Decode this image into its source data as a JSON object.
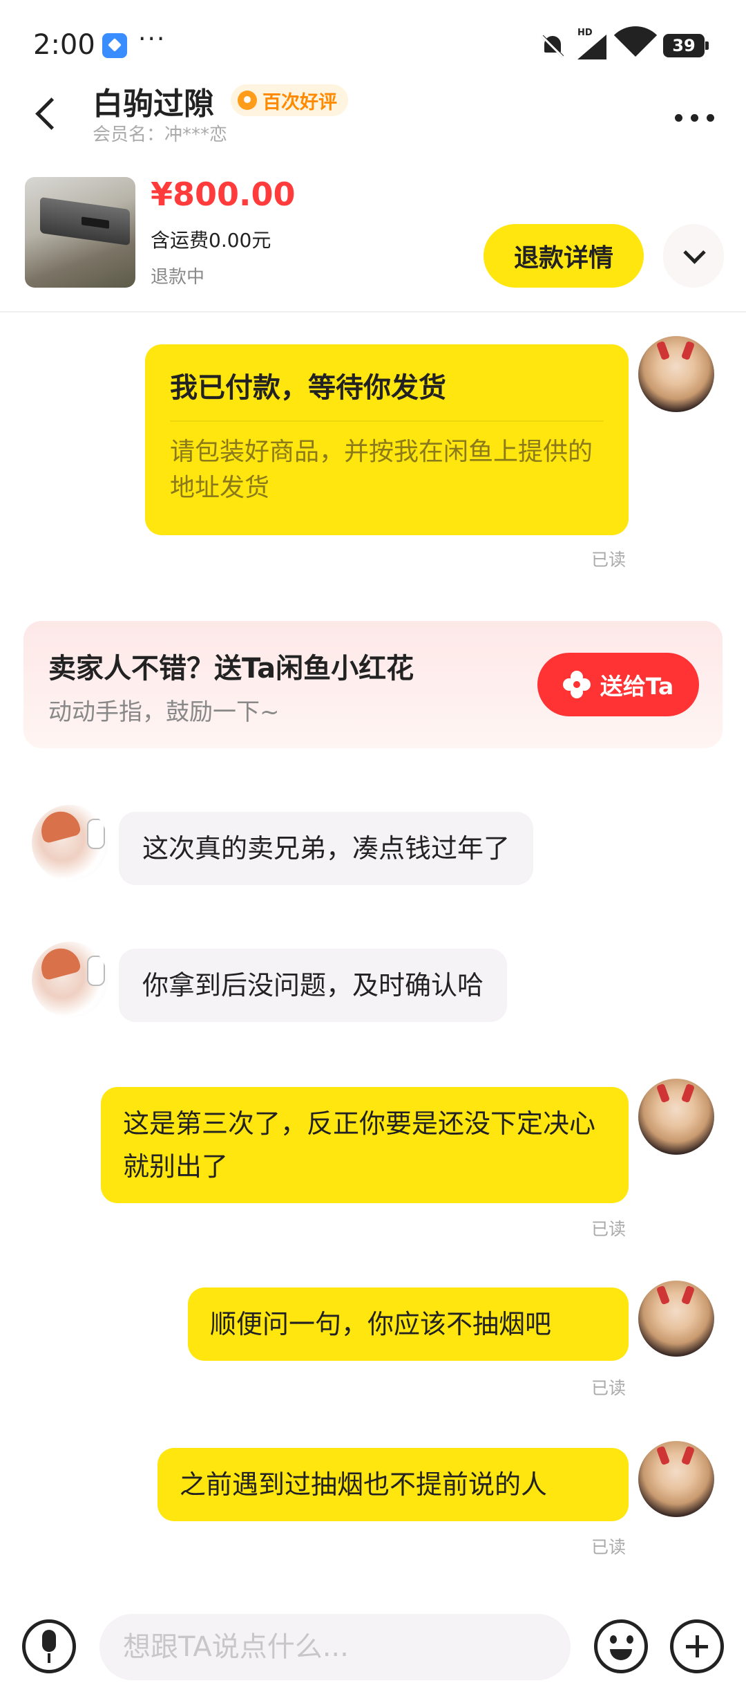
{
  "status_bar": {
    "time": "2:00",
    "network_label": "HD",
    "battery": "39"
  },
  "header": {
    "seller_name": "白驹过隙",
    "badge": "百次好评",
    "member_label": "会员名：冲***恋"
  },
  "product": {
    "price": "¥800.00",
    "shipping": "含运费0.00元",
    "status": "退款中",
    "refund_button": "退款详情"
  },
  "messages": {
    "card": {
      "title": "我已付款，等待你发货",
      "body": "请包装好商品，并按我在闲鱼上提供的地址发货",
      "read": "已读"
    },
    "seller_1": "这次真的卖兄弟，凑点钱过年了",
    "seller_2": "你拿到后没问题，及时确认哈",
    "me_1": {
      "text": "这是第三次了，反正你要是还没下定决心就别出了",
      "read": "已读"
    },
    "me_2": {
      "text": "顺便问一句，你应该不抽烟吧",
      "read": "已读"
    },
    "me_3": {
      "text": "之前遇到过抽烟也不提前说的人",
      "read": "已读"
    }
  },
  "flower_banner": {
    "title": "卖家人不错？送Ta闲鱼小红花",
    "subtitle": "动动手指，鼓励一下~",
    "button": "送给Ta"
  },
  "input": {
    "placeholder": "想跟TA说点什么..."
  },
  "colors": {
    "accent_yellow": "#ffe60f",
    "price_red": "#ff3b3b",
    "flower_red": "#ff3234",
    "badge_orange": "#ff8a00"
  },
  "icons": [
    "app-icon",
    "more-dots-icon",
    "mute-icon",
    "signal-icon",
    "wifi-icon",
    "battery-icon",
    "back-arrow-icon",
    "badge-icon",
    "more-icon",
    "chevron-down-icon",
    "flower-icon",
    "mic-icon",
    "emoji-icon",
    "plus-icon"
  ]
}
